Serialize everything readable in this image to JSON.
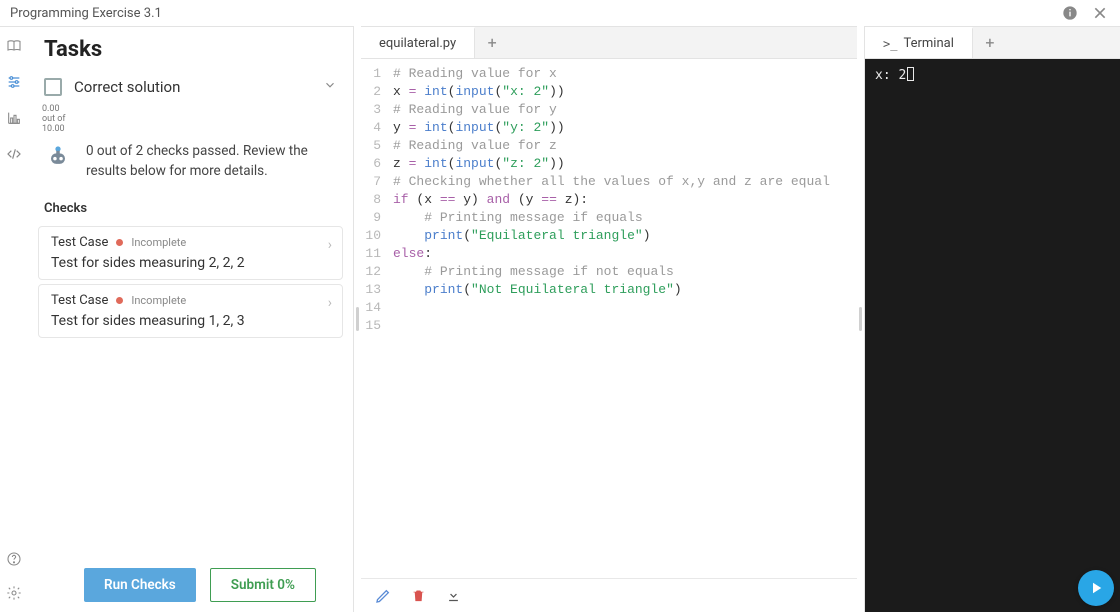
{
  "window": {
    "title": "Programming Exercise 3.1"
  },
  "rail": {
    "icons": [
      "book-icon",
      "sliders-icon",
      "chart-icon",
      "code-icon"
    ],
    "bottom": [
      "help-icon",
      "gear-icon"
    ]
  },
  "tasks": {
    "heading": "Tasks",
    "item": {
      "title": "Correct solution"
    },
    "score": {
      "earned": "0.00",
      "label_mid": "out of",
      "total": "10.00"
    },
    "bot_message": "0 out of 2 checks passed. Review the results below for more details.",
    "checks_label": "Checks",
    "checks": [
      {
        "name": "Test Case",
        "status": "Incomplete",
        "desc": "Test for sides measuring 2, 2, 2"
      },
      {
        "name": "Test Case",
        "status": "Incomplete",
        "desc": "Test for sides measuring 1, 2, 3"
      }
    ],
    "buttons": {
      "run": "Run Checks",
      "submit": "Submit 0%"
    }
  },
  "editor": {
    "tab": "equilateral.py",
    "code_lines": [
      [
        {
          "t": "# Reading value for x",
          "c": "c-comment"
        }
      ],
      [
        {
          "t": "x ",
          "c": "c-ident"
        },
        {
          "t": "=",
          "c": "c-op"
        },
        {
          "t": " ",
          "c": "c-ident"
        },
        {
          "t": "int",
          "c": "c-func"
        },
        {
          "t": "(",
          "c": "c-ident"
        },
        {
          "t": "input",
          "c": "c-func"
        },
        {
          "t": "(",
          "c": "c-ident"
        },
        {
          "t": "\"x: 2\"",
          "c": "c-str"
        },
        {
          "t": "))",
          "c": "c-ident"
        }
      ],
      [
        {
          "t": "# Reading value for y",
          "c": "c-comment"
        }
      ],
      [
        {
          "t": "y ",
          "c": "c-ident"
        },
        {
          "t": "=",
          "c": "c-op"
        },
        {
          "t": " ",
          "c": "c-ident"
        },
        {
          "t": "int",
          "c": "c-func"
        },
        {
          "t": "(",
          "c": "c-ident"
        },
        {
          "t": "input",
          "c": "c-func"
        },
        {
          "t": "(",
          "c": "c-ident"
        },
        {
          "t": "\"y: 2\"",
          "c": "c-str"
        },
        {
          "t": "))",
          "c": "c-ident"
        }
      ],
      [
        {
          "t": "# Reading value for z",
          "c": "c-comment"
        }
      ],
      [
        {
          "t": "z ",
          "c": "c-ident"
        },
        {
          "t": "=",
          "c": "c-op"
        },
        {
          "t": " ",
          "c": "c-ident"
        },
        {
          "t": "int",
          "c": "c-func"
        },
        {
          "t": "(",
          "c": "c-ident"
        },
        {
          "t": "input",
          "c": "c-func"
        },
        {
          "t": "(",
          "c": "c-ident"
        },
        {
          "t": "\"z: 2\"",
          "c": "c-str"
        },
        {
          "t": "))",
          "c": "c-ident"
        }
      ],
      [
        {
          "t": "# Checking whether all the values of x,y and z are equal",
          "c": "c-comment"
        }
      ],
      [
        {
          "t": "if",
          "c": "c-kw"
        },
        {
          "t": " (x ",
          "c": "c-ident"
        },
        {
          "t": "==",
          "c": "c-op"
        },
        {
          "t": " y) ",
          "c": "c-ident"
        },
        {
          "t": "and",
          "c": "c-kw"
        },
        {
          "t": " (y ",
          "c": "c-ident"
        },
        {
          "t": "==",
          "c": "c-op"
        },
        {
          "t": " z):",
          "c": "c-ident"
        }
      ],
      [
        {
          "t": "    ",
          "c": "c-ident"
        },
        {
          "t": "# Printing message if equals",
          "c": "c-comment"
        }
      ],
      [
        {
          "t": "    ",
          "c": "c-ident"
        },
        {
          "t": "print",
          "c": "c-func"
        },
        {
          "t": "(",
          "c": "c-ident"
        },
        {
          "t": "\"Equilateral triangle\"",
          "c": "c-str"
        },
        {
          "t": ")",
          "c": "c-ident"
        }
      ],
      [
        {
          "t": "else",
          "c": "c-kw"
        },
        {
          "t": ":",
          "c": "c-ident"
        }
      ],
      [
        {
          "t": "    ",
          "c": "c-ident"
        },
        {
          "t": "# Printing message if not equals",
          "c": "c-comment"
        }
      ],
      [
        {
          "t": "    ",
          "c": "c-ident"
        },
        {
          "t": "print",
          "c": "c-func"
        },
        {
          "t": "(",
          "c": "c-ident"
        },
        {
          "t": "\"Not Equilateral triangle\"",
          "c": "c-str"
        },
        {
          "t": ")",
          "c": "c-ident"
        }
      ],
      [
        {
          "t": "",
          "c": "c-ident"
        }
      ],
      [
        {
          "t": "",
          "c": "c-ident"
        }
      ]
    ]
  },
  "terminal": {
    "tab_prefix": ">_",
    "tab_label": "Terminal",
    "content": "x: 2"
  }
}
